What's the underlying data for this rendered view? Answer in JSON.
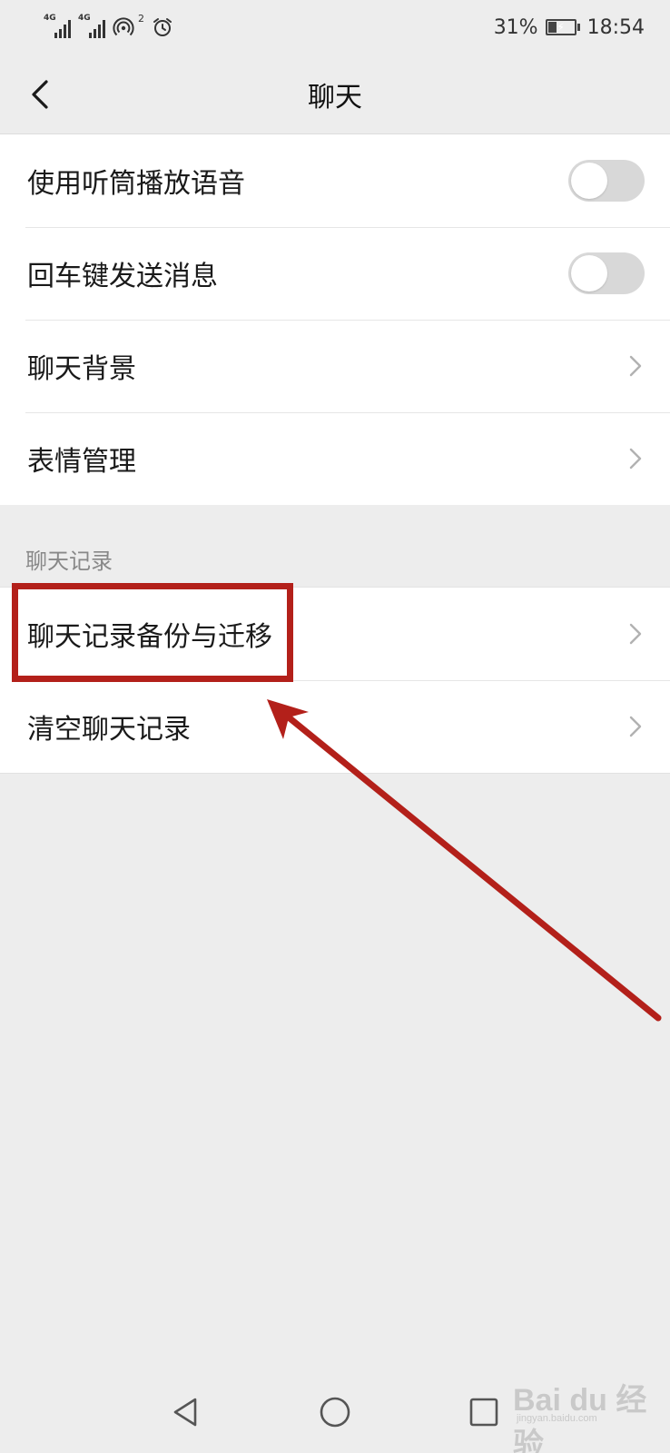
{
  "status_bar": {
    "signal1_label": "4G",
    "signal2_label": "4G",
    "hotspot_count": "2",
    "battery": "31%",
    "time": "18:54"
  },
  "header": {
    "title": "聊天",
    "back_icon": "chevron-left-icon"
  },
  "settings": {
    "group1": [
      {
        "label": "使用听筒播放语音",
        "control": "toggle",
        "on": false
      },
      {
        "label": "回车键发送消息",
        "control": "toggle",
        "on": false
      },
      {
        "label": "聊天背景",
        "control": "chevron"
      },
      {
        "label": "表情管理",
        "control": "chevron"
      }
    ],
    "section_header": "聊天记录",
    "group2": [
      {
        "label": "聊天记录备份与迁移",
        "control": "chevron"
      },
      {
        "label": "清空聊天记录",
        "control": "chevron"
      }
    ]
  },
  "annotation": {
    "color": "#b3201a"
  },
  "nav_bar": {
    "icons": [
      "back-triangle-icon",
      "home-circle-icon",
      "recents-square-icon"
    ]
  },
  "watermark": {
    "main": "Bai du 经验",
    "sub": "jingyan.baidu.com"
  }
}
